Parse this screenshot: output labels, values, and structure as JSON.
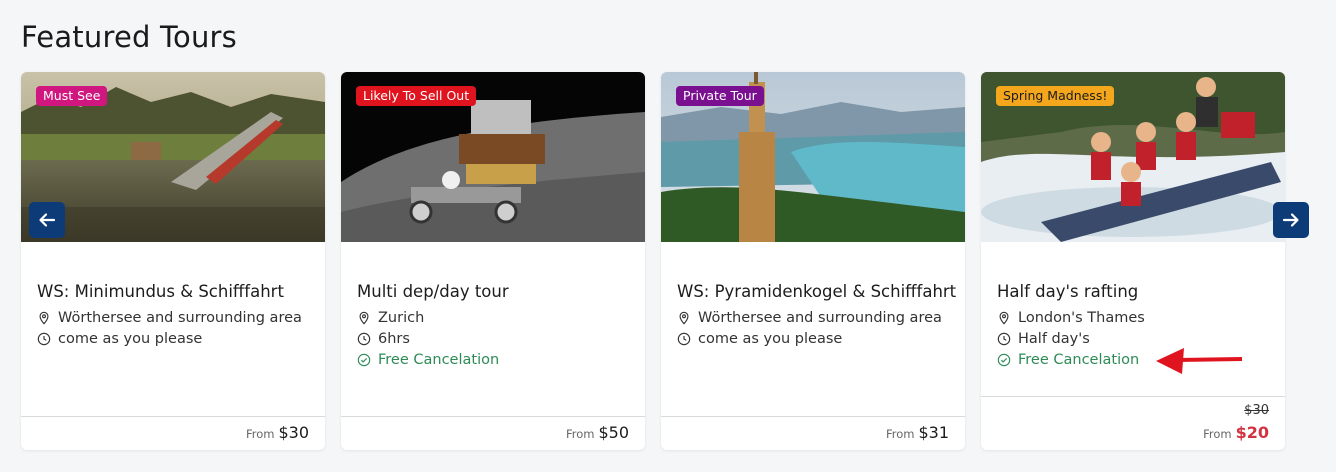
{
  "section": {
    "title": "Featured Tours"
  },
  "carousel": {
    "prev_icon": "arrow-left-icon",
    "next_icon": "arrow-right-icon"
  },
  "cards": [
    {
      "badge": "Must See",
      "badge_color": "#d0167f",
      "title": "WS: Minimundus & Schifffahrt",
      "location": "Wörthersee and surrounding area",
      "duration": "come as you please",
      "from_label": "From",
      "price": "$30"
    },
    {
      "badge": "Likely To Sell Out",
      "badge_color": "#e0141e",
      "title": "Multi dep/day tour",
      "location": "Zurich",
      "duration": "6hrs",
      "cancelation": "Free Cancelation",
      "from_label": "From",
      "price": "$50"
    },
    {
      "badge": "Private Tour",
      "badge_color": "#7a0f8f",
      "title": "WS: Pyramidenkogel & Schifffahrt",
      "location": "Wörthersee and surrounding area",
      "duration": "come as you please",
      "from_label": "From",
      "price": "$31"
    },
    {
      "badge": "Spring Madness!",
      "badge_color": "#f4a71d",
      "title": "Half day's rafting",
      "location": "London's Thames",
      "duration": "Half day's",
      "cancelation": "Free Cancelation",
      "old_price": "$30",
      "from_label": "From",
      "price": "$20"
    }
  ],
  "colors": {
    "accent_nav": "#0d3b78",
    "cancel_green": "#2e8b57",
    "sale_red": "#d23242",
    "annotation_red": "#e0141e"
  }
}
